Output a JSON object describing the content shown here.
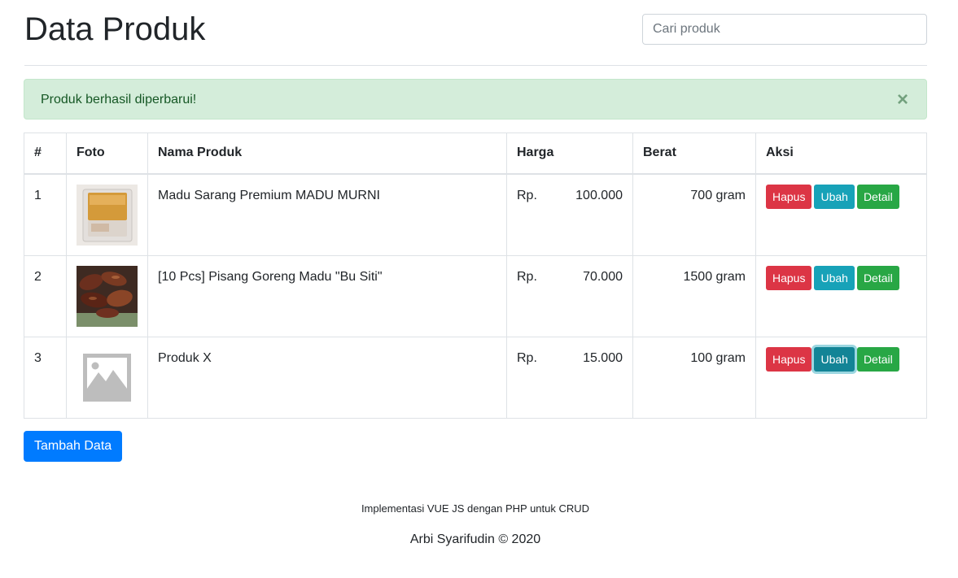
{
  "header": {
    "title": "Data Produk"
  },
  "search": {
    "placeholder": "Cari produk",
    "value": ""
  },
  "alert": {
    "message": "Produk berhasil diperbarui!",
    "close": "×",
    "color": "#d4edda"
  },
  "table": {
    "columns": [
      "#",
      "Foto",
      "Nama Produk",
      "Harga",
      "Berat",
      "Aksi"
    ],
    "rows": [
      {
        "no": "1",
        "photo": "honeycomb-photo",
        "name": "Madu Sarang Premium MADU MURNI",
        "currency": "Rp.",
        "price": "100.000",
        "weight": "700 gram"
      },
      {
        "no": "2",
        "photo": "fried-banana-photo",
        "name": "[10 Pcs] Pisang Goreng Madu \"Bu Siti\"",
        "currency": "Rp.",
        "price": "70.000",
        "weight": "1500 gram"
      },
      {
        "no": "3",
        "photo": "image-placeholder-icon",
        "name": "Produk X",
        "currency": "Rp.",
        "price": "15.000",
        "weight": "100 gram"
      }
    ],
    "actions": {
      "delete": "Hapus",
      "edit": "Ubah",
      "detail": "Detail"
    }
  },
  "add_button": "Tambah Data",
  "footer": {
    "note": "Implementasi VUE JS dengan PHP untuk CRUD",
    "credit": "Arbi Syarifudin © 2020"
  },
  "colors": {
    "primary": "#007bff",
    "danger": "#dc3545",
    "info": "#17a2b8",
    "success": "#28a745"
  }
}
